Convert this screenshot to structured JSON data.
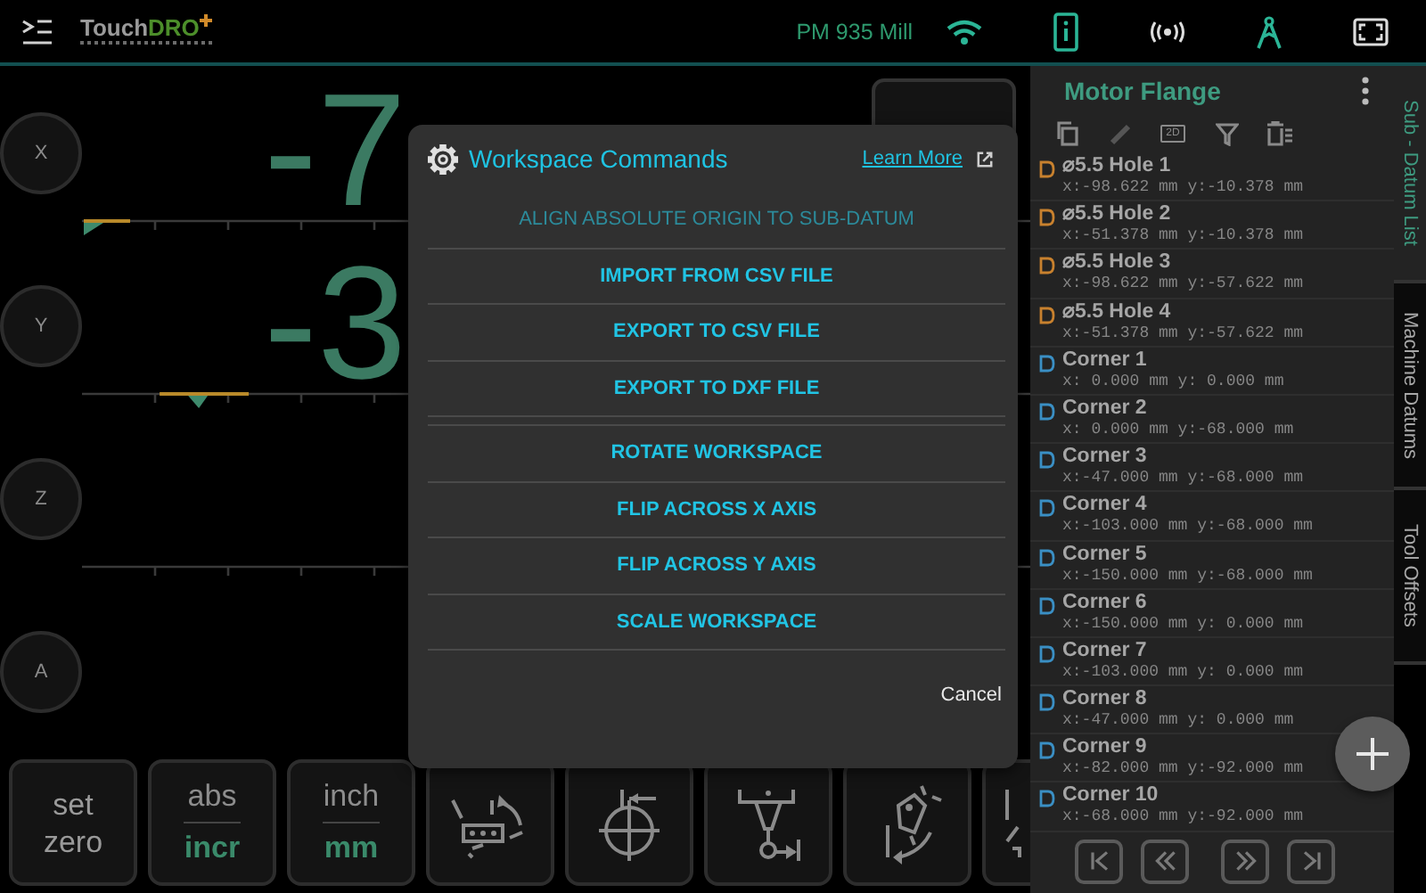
{
  "status_bar": {
    "logo": {
      "text": "Touch",
      "accent": "DRO"
    },
    "machine": "PM 935 Mill"
  },
  "axes": [
    {
      "label": "X",
      "readout": "-7",
      "scale": true,
      "level": 0.0
    },
    {
      "label": "Y",
      "readout": "-3",
      "scale": true,
      "level": 0.08
    },
    {
      "label": "Z",
      "scale": true
    },
    {
      "label": "A"
    }
  ],
  "toolbar": [
    {
      "kind": "label",
      "lines": [
        "set",
        "zero"
      ]
    },
    {
      "kind": "toggle",
      "options": [
        {
          "label": "abs",
          "selected": false
        },
        {
          "label": "incr",
          "selected": true
        }
      ]
    },
    {
      "kind": "toggle",
      "options": [
        {
          "label": "inch",
          "selected": false
        },
        {
          "label": "mm",
          "selected": true
        }
      ]
    },
    {
      "kind": "icon"
    },
    {
      "kind": "icon"
    },
    {
      "kind": "icon"
    },
    {
      "kind": "icon"
    },
    {
      "kind": "icon"
    }
  ],
  "dialog": {
    "title": "Workspace Commands",
    "link": "Learn More",
    "command_groups": [
      [
        {
          "label": "ALIGN ABSOLUTE ORIGIN TO SUB-DATUM",
          "disabled": true
        },
        {
          "label": "IMPORT FROM CSV FILE",
          "disabled": false
        },
        {
          "label": "EXPORT TO CSV FILE",
          "disabled": false
        },
        {
          "label": "EXPORT TO DXF FILE",
          "disabled": false
        }
      ],
      [
        {
          "label": "ROTATE WORKSPACE",
          "disabled": false
        },
        {
          "label": "FLIP ACROSS X AXIS",
          "disabled": false
        },
        {
          "label": "FLIP ACROSS Y AXIS",
          "disabled": false
        },
        {
          "label": "SCALE WORKSPACE",
          "disabled": false
        }
      ]
    ],
    "cancel": "Cancel"
  },
  "panel": {
    "title": "Motor Flange",
    "view_toggle": "2D",
    "items": [
      {
        "name": "⌀5.5 Hole 1",
        "coords": "x:-98.622 mm y:-10.378 mm",
        "color": "#c8812e"
      },
      {
        "name": "⌀5.5 Hole 2",
        "coords": "x:-51.378 mm y:-10.378 mm",
        "color": "#c8812e"
      },
      {
        "name": "⌀5.5 Hole 3",
        "coords": "x:-98.622 mm y:-57.622 mm",
        "color": "#c8812e"
      },
      {
        "name": "⌀5.5 Hole 4",
        "coords": "x:-51.378 mm y:-57.622 mm",
        "color": "#c8812e"
      },
      {
        "name": "Corner 1",
        "coords": "x: 0.000 mm y: 0.000 mm",
        "color": "#3a8fc4"
      },
      {
        "name": "Corner 2",
        "coords": "x: 0.000 mm y:-68.000 mm",
        "color": "#3a8fc4"
      },
      {
        "name": "Corner 3",
        "coords": "x:-47.000 mm y:-68.000 mm",
        "color": "#3a8fc4"
      },
      {
        "name": "Corner 4",
        "coords": "x:-103.000 mm y:-68.000 mm",
        "color": "#3a8fc4"
      },
      {
        "name": "Corner 5",
        "coords": "x:-150.000 mm y:-68.000 mm",
        "color": "#3a8fc4"
      },
      {
        "name": "Corner 6",
        "coords": "x:-150.000 mm y: 0.000 mm",
        "color": "#3a8fc4"
      },
      {
        "name": "Corner 7",
        "coords": "x:-103.000 mm y: 0.000 mm",
        "color": "#3a8fc4"
      },
      {
        "name": "Corner 8",
        "coords": "x:-47.000 mm y: 0.000 mm",
        "color": "#3a8fc4"
      },
      {
        "name": "Corner 9",
        "coords": "x:-82.000 mm y:-92.000 mm",
        "color": "#3a8fc4"
      },
      {
        "name": "Corner 10",
        "coords": "x:-68.000 mm y:-92.000 mm",
        "color": "#3a8fc4"
      }
    ]
  },
  "tabs": [
    {
      "label": "Sub - Datum List",
      "selected": true
    },
    {
      "label": "Machine Datums",
      "selected": false
    },
    {
      "label": "Tool Offsets",
      "selected": false
    }
  ]
}
